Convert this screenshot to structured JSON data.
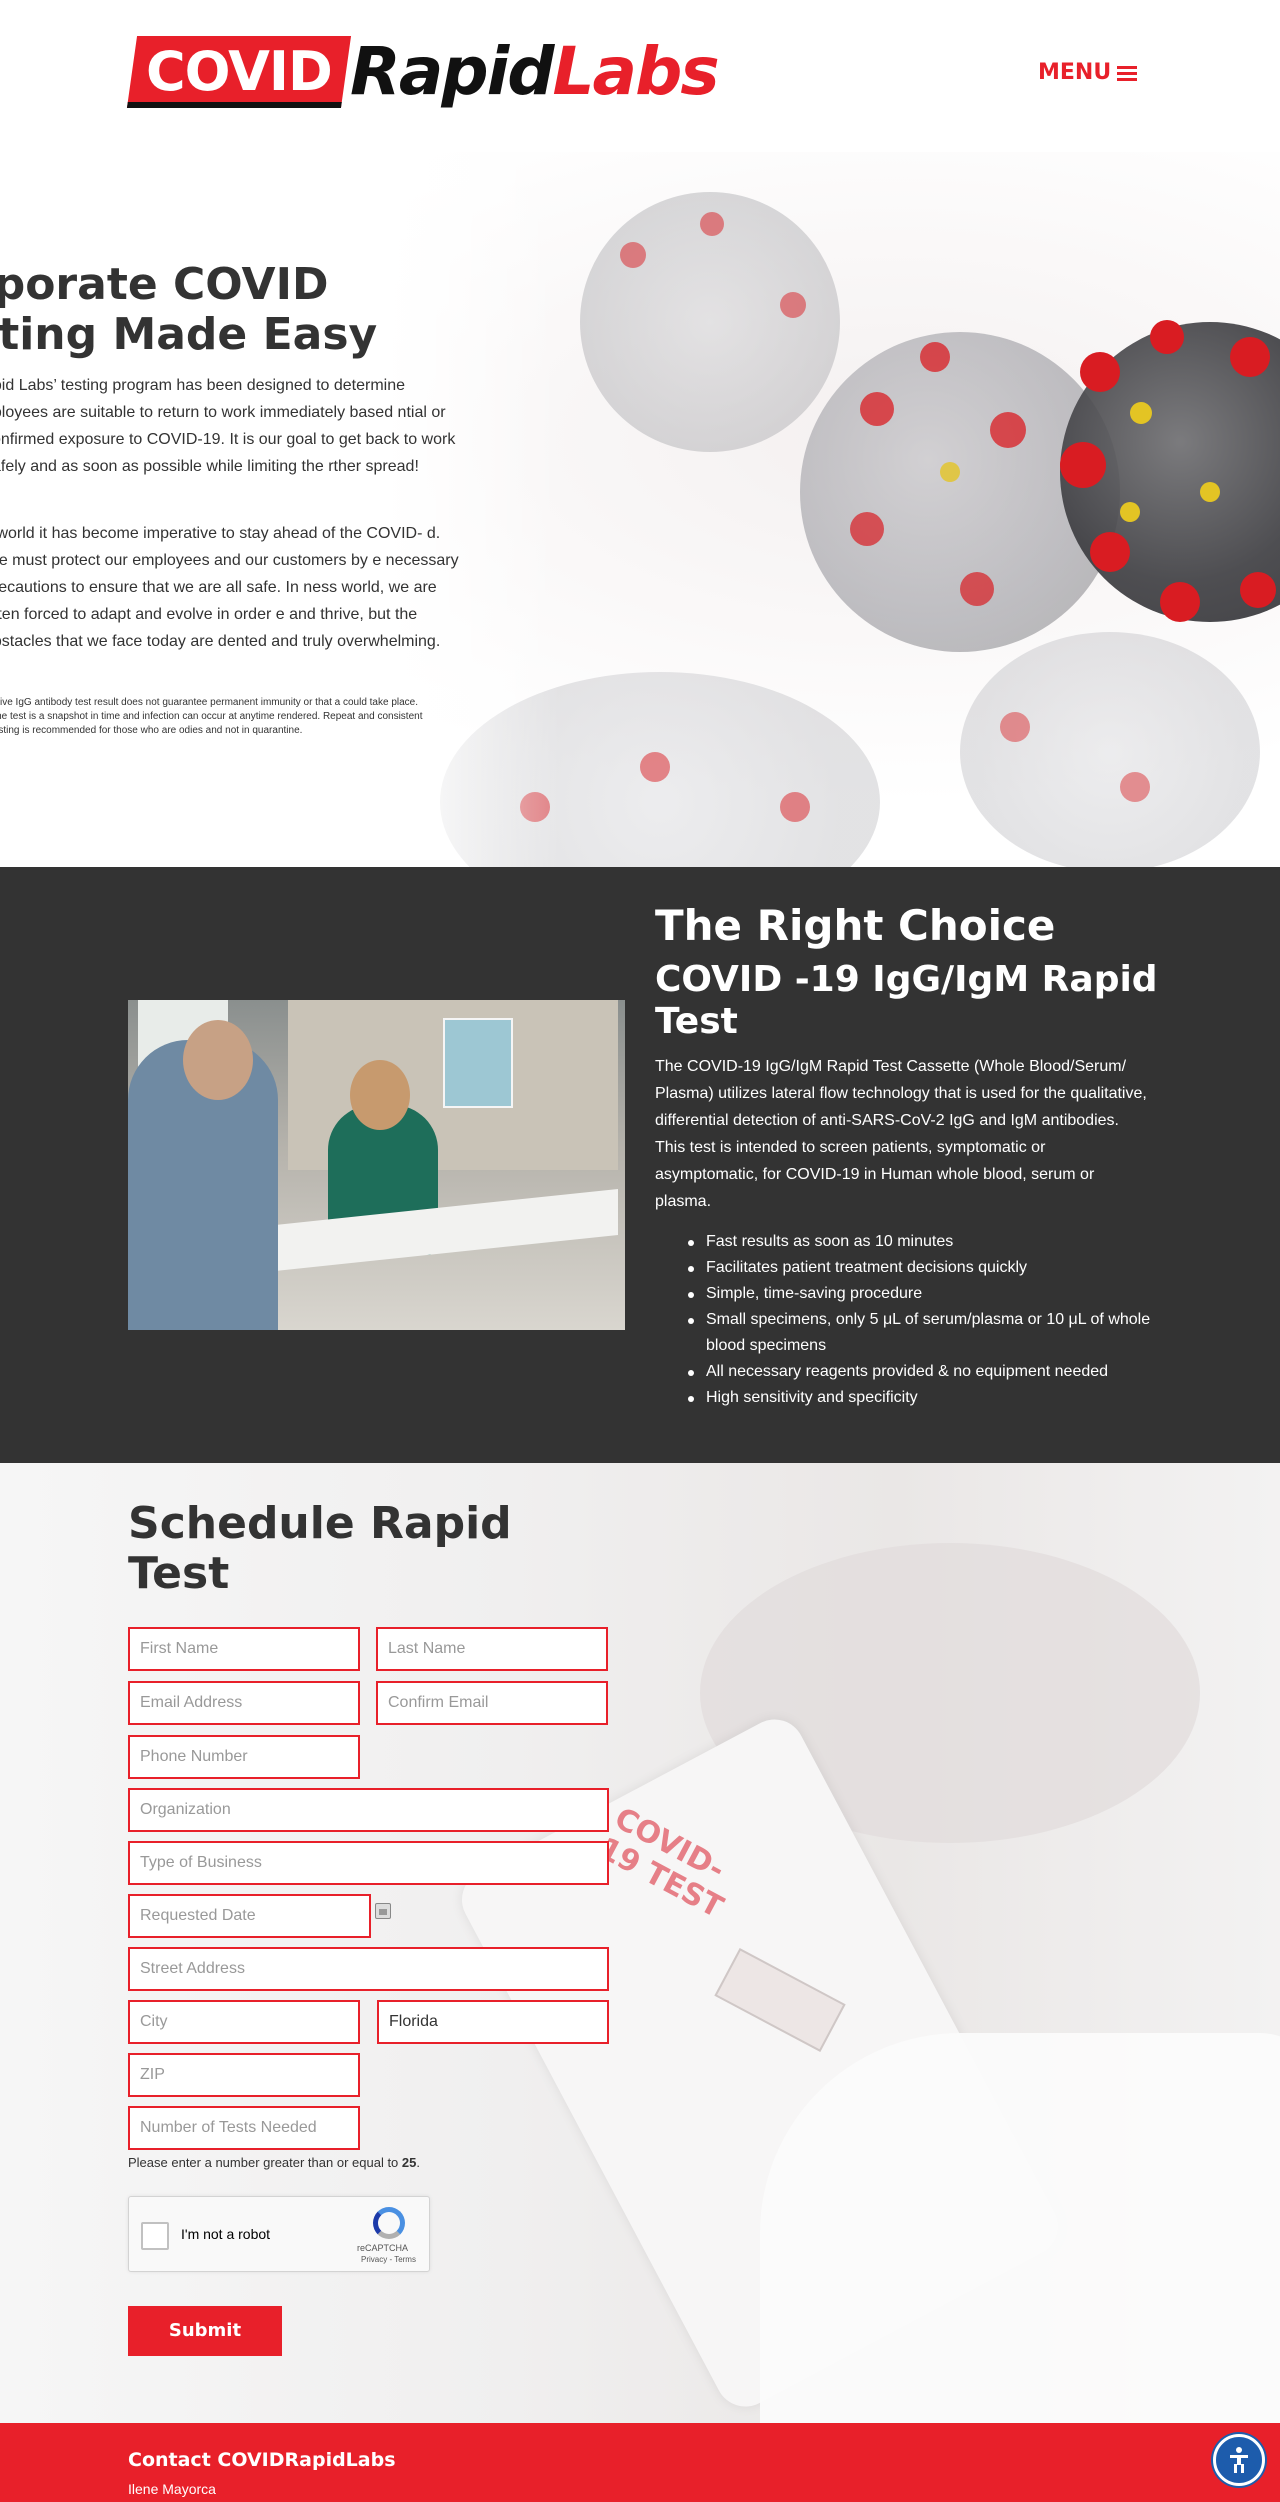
{
  "brand": {
    "logo_covid": "COVID",
    "logo_rapid": "Rapid",
    "logo_labs": "Labs",
    "accent": "#e8202a"
  },
  "nav": {
    "menu_label": "MENU",
    "menu_icon": "hamburger-icon"
  },
  "hero": {
    "title_line1": "rporate COVID",
    "title_line2": "sting Made Easy",
    "p1": "apid Labs’ testing program has been designed to determine nployees are suitable to return to work immediately based ntial or confirmed exposure to COVID-19.  It is our goal to get back to work safely and as soon as possible while limiting the rther spread!",
    "p2": "s world it has become imperative to stay ahead of the COVID- d.  We must protect our employees and our customers by e necessary precautions to ensure that we are all safe.  In ness world, we are often forced to adapt and evolve in order e and thrive, but the obstacles that we face today are dented and truly overwhelming.",
    "note": "sitive IgG antibody test result does not guarantee permanent immunity or that a could take place. The test is a snapshot in time and infection can occur at anytime rendered.  Repeat and consistent testing is recommended for those who are odies and not in quarantine."
  },
  "choice": {
    "title": "The Right Choice",
    "subtitle": "COVID -19 IgG/IgM Rapid Test",
    "description": "The COVID-19 IgG/IgM Rapid Test Cassette (Whole Blood/Serum/ Plasma) utilizes lateral flow technology that is used for the qualitative, differential detection of anti-SARS-CoV-2 IgG and IgM antibodies. This test is intended to screen patients, symptomatic or asymptomatic, for COVID-19 in Human whole blood, serum or plasma.",
    "bullets": [
      "Fast results as soon as 10 minutes",
      "Facilitates patient treatment decisions quickly",
      "Simple, time-saving procedure",
      "Small specimens, only 5 μL of serum/plasma or 10 μL of whole blood specimens",
      "All necessary reagents provided & no equipment needed",
      "High sensitivity and specificity"
    ]
  },
  "schedule": {
    "title": "Schedule Rapid Test",
    "cassette_label": "COVID-19 TEST",
    "fields": {
      "first_name": "First Name",
      "last_name": "Last Name",
      "email": "Email Address",
      "confirm_email": "Confirm Email",
      "phone": "Phone Number",
      "organization": "Organization",
      "business_type": "Type of Business",
      "requested_date": "Requested Date",
      "street": "Street Address",
      "city": "City",
      "state_value": "Florida",
      "zip": "ZIP",
      "num_tests": "Number of Tests Needed"
    },
    "hint_prefix": "Please enter a number greater than or equal to ",
    "hint_value": "25",
    "hint_suffix": ".",
    "captcha_label": "I'm not a robot",
    "captcha_brand": "reCAPTCHA",
    "captcha_terms": "Privacy - Terms",
    "submit_label": "Submit"
  },
  "footer": {
    "title": "Contact COVIDRapidLabs",
    "name": "Ilene Mayorca"
  }
}
